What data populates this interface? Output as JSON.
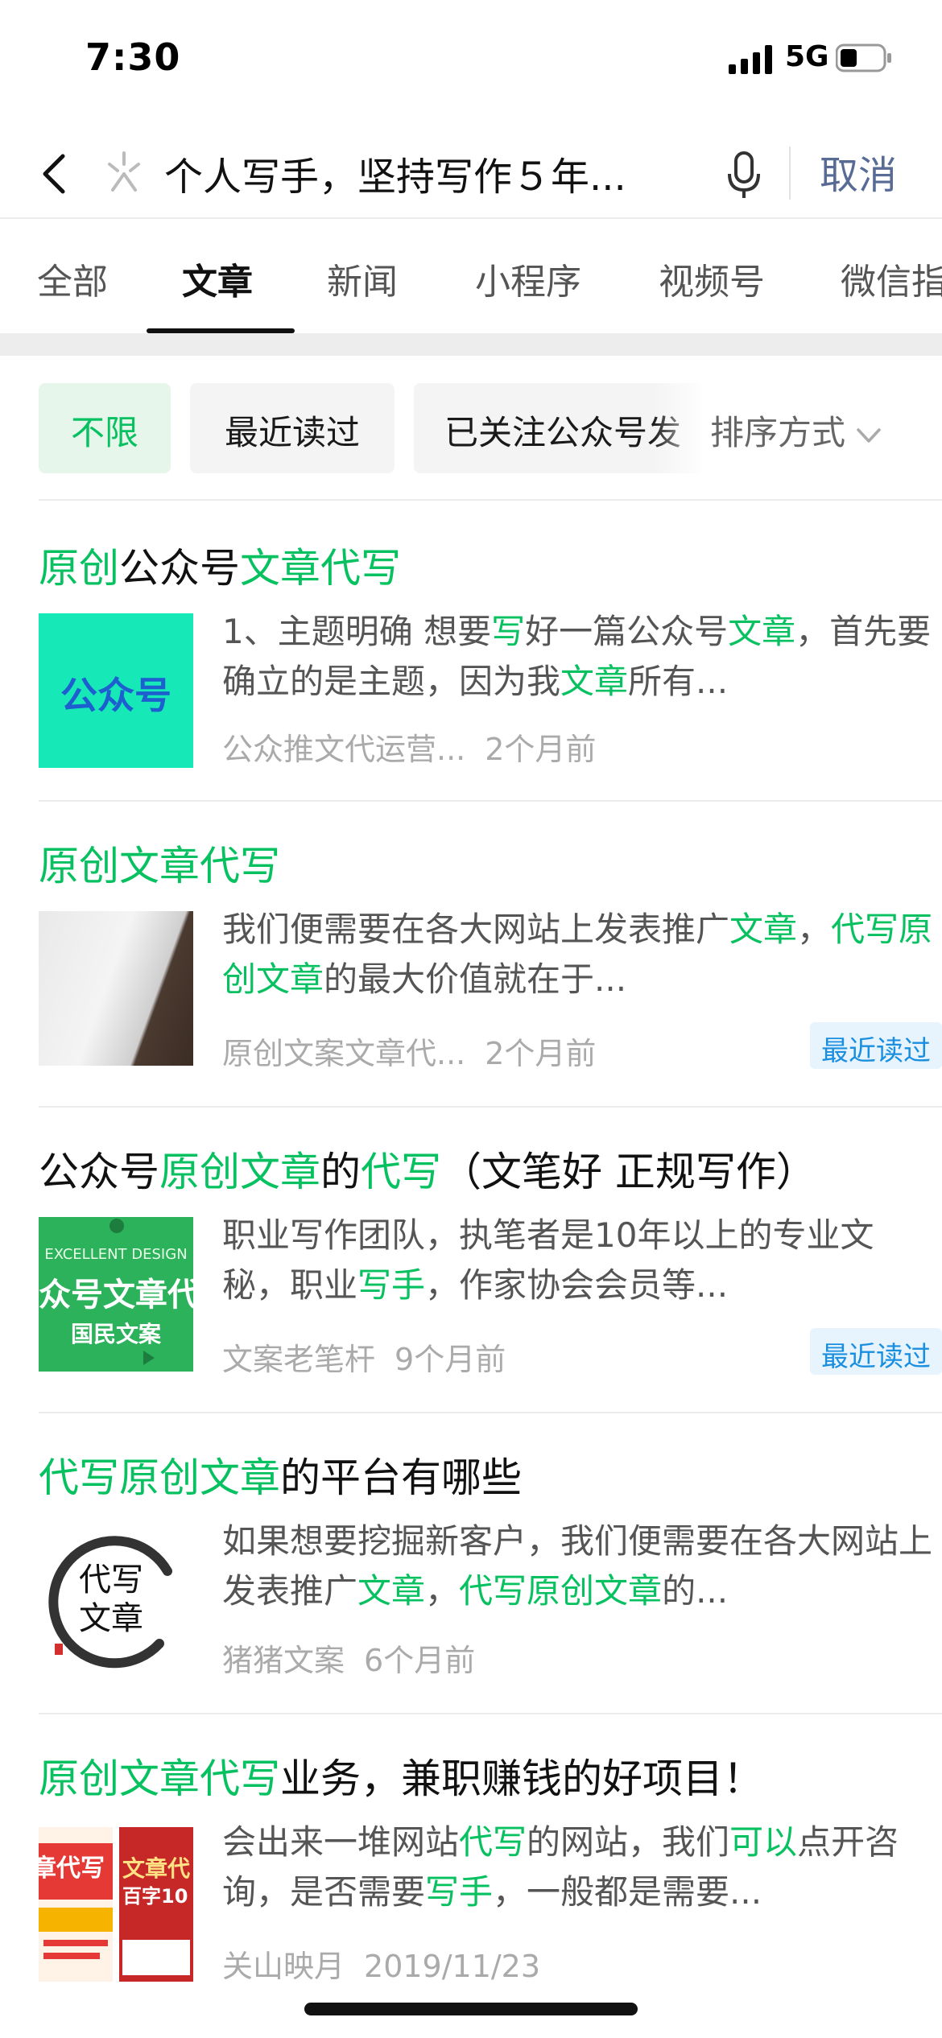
{
  "status_bar": {
    "time": "7:30",
    "network": "5G"
  },
  "search": {
    "query": "个人写手，坚持写作５年...",
    "cancel_label": "取消"
  },
  "tabs": [
    {
      "label": "全部",
      "active": false
    },
    {
      "label": "文章",
      "active": true
    },
    {
      "label": "新闻",
      "active": false
    },
    {
      "label": "小程序",
      "active": false
    },
    {
      "label": "视频号",
      "active": false
    },
    {
      "label": "微信指",
      "active": false
    }
  ],
  "filters": {
    "chips": [
      "不限",
      "最近读过",
      "已关注公众号发"
    ],
    "active_index": 0,
    "sort_label": "排序方式"
  },
  "results": [
    {
      "title": [
        [
          "原创",
          true
        ],
        [
          "公众号",
          false
        ],
        [
          "文章代写",
          true
        ]
      ],
      "snippet": [
        [
          "1、主题明确 想要",
          false
        ],
        [
          "写",
          true
        ],
        [
          "好一篇公众号",
          false
        ],
        [
          "文章",
          true
        ],
        [
          "，首先要确立的是主题，因为我",
          false
        ],
        [
          "文章",
          true
        ],
        [
          "所有...",
          false
        ]
      ],
      "source": "公众推文代运营...",
      "date": "2个月前",
      "badge": "",
      "thumb_text": "公众号"
    },
    {
      "title": [
        [
          "原创文章代写",
          true
        ]
      ],
      "snippet": [
        [
          "我们便需要在各大网站上发表推广",
          false
        ],
        [
          "文章",
          true
        ],
        [
          "，",
          false
        ],
        [
          "代写原创文章",
          true
        ],
        [
          "的最大价值就在于...",
          false
        ]
      ],
      "source": "原创文案文章代...",
      "date": "2个月前",
      "badge": "最近读过",
      "thumb_text": ""
    },
    {
      "title": [
        [
          "公众号",
          false
        ],
        [
          "原创文章",
          true
        ],
        [
          "的",
          false
        ],
        [
          "代写",
          true
        ],
        [
          "（文笔好 正规写作）",
          false
        ]
      ],
      "snippet": [
        [
          "职业写作团队，执笔者是10年以上的专业文秘，职业",
          false
        ],
        [
          "写手",
          true
        ],
        [
          "，作家协会会员等...",
          false
        ]
      ],
      "source": "文案老笔杆",
      "date": "9个月前",
      "badge": "最近读过",
      "thumb_text": [
        "EXCELLENT DESIGN",
        "众号文章代",
        "国民文案"
      ]
    },
    {
      "title": [
        [
          "代写原创文章",
          true
        ],
        [
          "的平台有哪些",
          false
        ]
      ],
      "snippet": [
        [
          "如果想要挖掘新客户，我们便需要在各大网站上发表推广",
          false
        ],
        [
          "文章",
          true
        ],
        [
          "，",
          false
        ],
        [
          "代写原创文章",
          true
        ],
        [
          "的...",
          false
        ]
      ],
      "source": "猪猪文案",
      "date": "6个月前",
      "badge": "",
      "thumb_text": [
        "代写",
        "文章"
      ]
    },
    {
      "title": [
        [
          "原创文章代写",
          true
        ],
        [
          "业务，兼职赚钱的好项目！",
          false
        ]
      ],
      "snippet": [
        [
          "会出来一堆网站",
          false
        ],
        [
          "代写",
          true
        ],
        [
          "的网站，我们",
          false
        ],
        [
          "可以",
          true
        ],
        [
          "点开咨询，是否需要",
          false
        ],
        [
          "写手",
          true
        ],
        [
          "，一般都是需要...",
          false
        ]
      ],
      "source": "关山映月",
      "date": "2019/11/23",
      "badge": "",
      "thumb_text": [
        "章代写",
        "文章代",
        "百字10"
      ]
    }
  ],
  "colors": {
    "highlight": "#07c160",
    "link": "#576b95",
    "badge_text": "#1a8fe0",
    "badge_bg": "#e8f4fd"
  }
}
